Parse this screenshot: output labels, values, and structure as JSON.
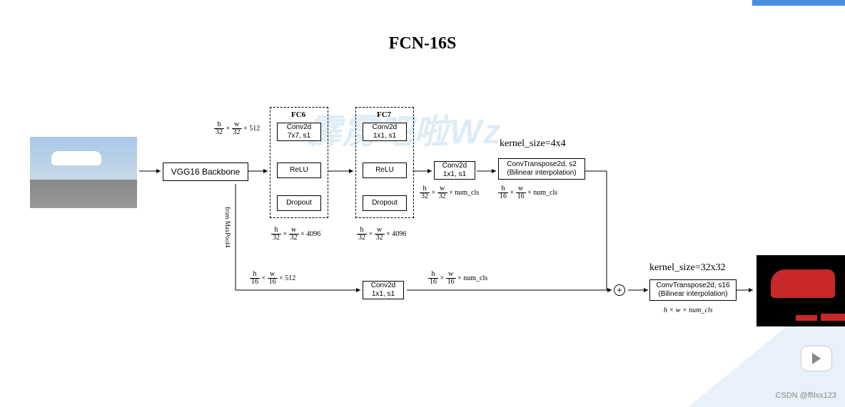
{
  "title": "FCN-16S",
  "watermark": "霹雳吧啦Wz",
  "backbone": {
    "label": "VGG16 Backbone",
    "input_dims": "h/32 × w/32 × 512",
    "branch_label": "from MaxPool4"
  },
  "fc6": {
    "title": "FC6",
    "conv": "Conv2d\n7x7, s1",
    "relu": "ReLU",
    "dropout": "Dropout",
    "out": "h/32 × w/32 × 4096"
  },
  "fc7": {
    "title": "FC7",
    "conv": "Conv2d\n1x1, s1",
    "relu": "ReLU",
    "dropout": "Dropout",
    "out": "h/32 × w/32 × 4096"
  },
  "conv_cls": {
    "label": "Conv2d\n1x1, s1",
    "out": "h/32 × w/32 × num_cls"
  },
  "upconv1": {
    "note": "kernel_size=4x4",
    "label": "ConvTranspose2d, s2\n(Bilinear interpolation)",
    "out": "h/16 × w/16 × num_cls"
  },
  "branch": {
    "in": "h/16 × w/16 × 512",
    "conv": "Conv2d\n1x1, s1",
    "out": "h/16 × w/16 × num_cls"
  },
  "upconv2": {
    "note": "kernel_size=32x32",
    "label": "ConvTranspose2d, s16\n(Bilinear interpolation)",
    "out": "h × w × num_cls"
  },
  "credit": "CSDN @ffilxx123"
}
